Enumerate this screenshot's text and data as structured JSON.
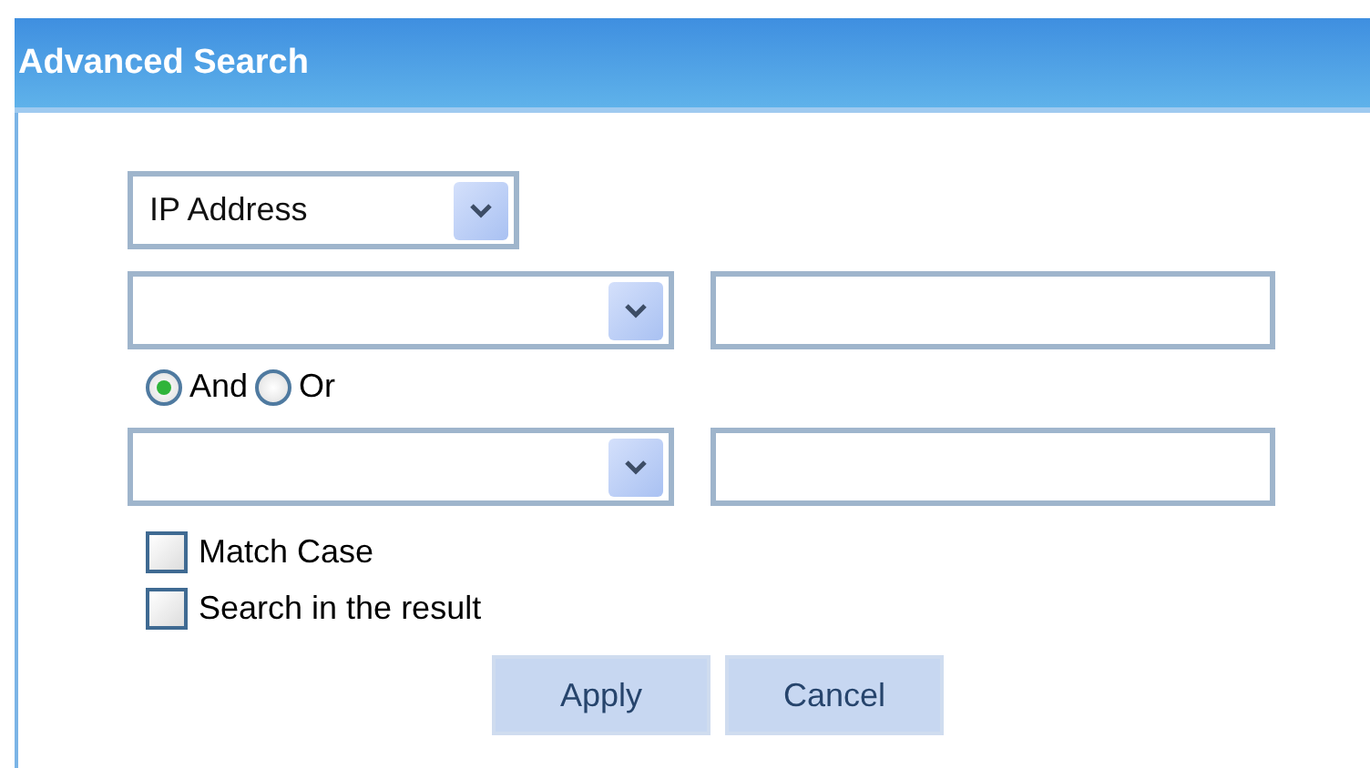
{
  "window": {
    "title": "Advanced Search"
  },
  "field_select": {
    "value": "IP Address"
  },
  "conditions": [
    {
      "kind": "select_and_text"
    },
    {
      "kind": "select_and_text"
    }
  ],
  "logic": [
    {
      "label": "And",
      "selected": true
    },
    {
      "label": "Or",
      "selected": false
    }
  ],
  "options": [
    {
      "label": "Match Case",
      "checked": false
    },
    {
      "label": "Search in the result",
      "checked": false
    }
  ],
  "buttons": [
    "Apply",
    "Cancel"
  ]
}
